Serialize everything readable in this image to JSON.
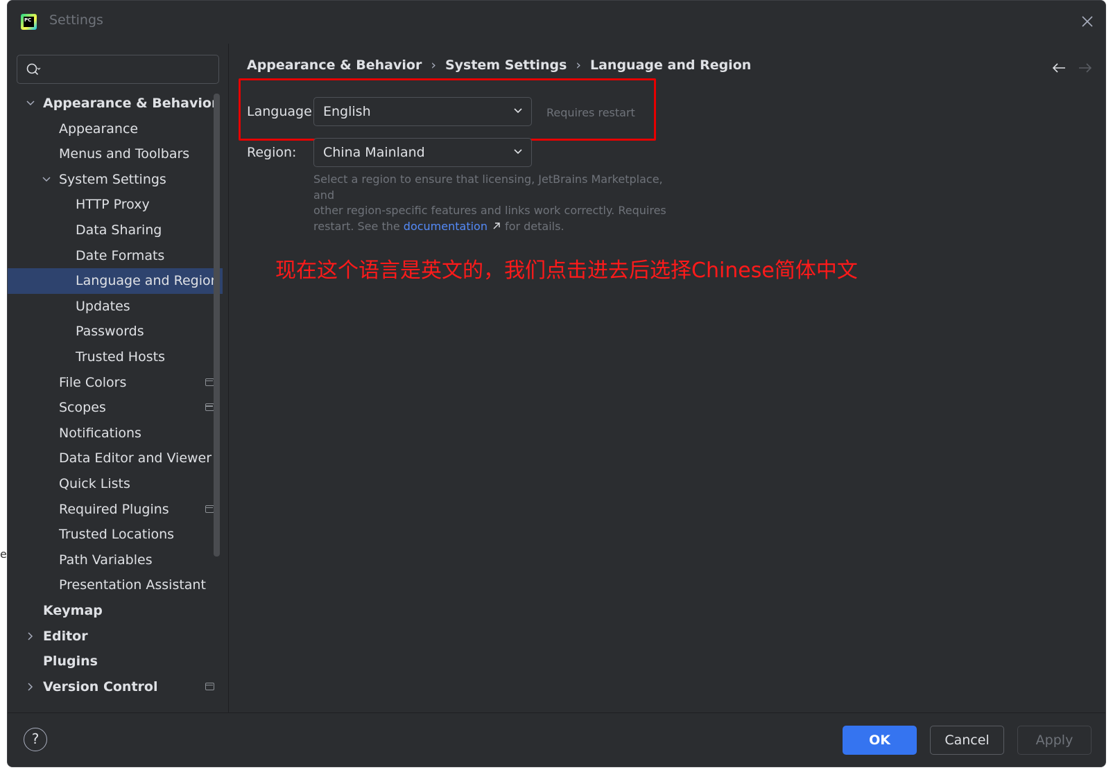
{
  "window": {
    "title": "Settings"
  },
  "sidebar": {
    "search_placeholder": "",
    "items": [
      {
        "label": "Appearance & Behavior",
        "level": 0,
        "bold": true,
        "expanded": true
      },
      {
        "label": "Appearance",
        "level": 1
      },
      {
        "label": "Menus and Toolbars",
        "level": 1
      },
      {
        "label": "System Settings",
        "level": 1,
        "expanded": true
      },
      {
        "label": "HTTP Proxy",
        "level": 2
      },
      {
        "label": "Data Sharing",
        "level": 2
      },
      {
        "label": "Date Formats",
        "level": 2
      },
      {
        "label": "Language and Region",
        "level": 2,
        "selected": true
      },
      {
        "label": "Updates",
        "level": 2
      },
      {
        "label": "Passwords",
        "level": 2
      },
      {
        "label": "Trusted Hosts",
        "level": 2
      },
      {
        "label": "File Colors",
        "level": 1,
        "project_icon": true
      },
      {
        "label": "Scopes",
        "level": 1,
        "project_icon": true
      },
      {
        "label": "Notifications",
        "level": 1
      },
      {
        "label": "Data Editor and Viewer",
        "level": 1
      },
      {
        "label": "Quick Lists",
        "level": 1
      },
      {
        "label": "Required Plugins",
        "level": 1,
        "project_icon": true
      },
      {
        "label": "Trusted Locations",
        "level": 1
      },
      {
        "label": "Path Variables",
        "level": 1
      },
      {
        "label": "Presentation Assistant",
        "level": 1
      },
      {
        "label": "Keymap",
        "level": 0,
        "bold": true
      },
      {
        "label": "Editor",
        "level": 0,
        "bold": true,
        "expanded": false
      },
      {
        "label": "Plugins",
        "level": 0,
        "bold": true
      },
      {
        "label": "Version Control",
        "level": 0,
        "bold": true,
        "expanded": false,
        "project_icon": true
      }
    ]
  },
  "breadcrumb": {
    "parts": [
      "Appearance & Behavior",
      "System Settings",
      "Language and Region"
    ],
    "separator": "›"
  },
  "form": {
    "language_label": "Language:",
    "language_value": "English",
    "requires_restart": "Requires restart",
    "region_label": "Region:",
    "region_value": "China Mainland",
    "desc_line1": "Select a region to ensure that licensing, JetBrains Marketplace, and",
    "desc_line2": "other region-specific features and links work correctly. Requires",
    "desc_line3_prefix": "restart. See the ",
    "desc_link": "documentation",
    "desc_line3_suffix": " for details."
  },
  "annotation": "现在这个语言是英文的，我们点击进去后选择Chinese简体中文",
  "footer": {
    "help": "?",
    "ok": "OK",
    "cancel": "Cancel",
    "apply": "Apply"
  },
  "background_fragment": "e",
  "colors": {
    "bg": "#2b2d30",
    "selection": "#2e436e",
    "accent": "#3574f0",
    "link": "#548af7",
    "highlight": "#e60000"
  }
}
